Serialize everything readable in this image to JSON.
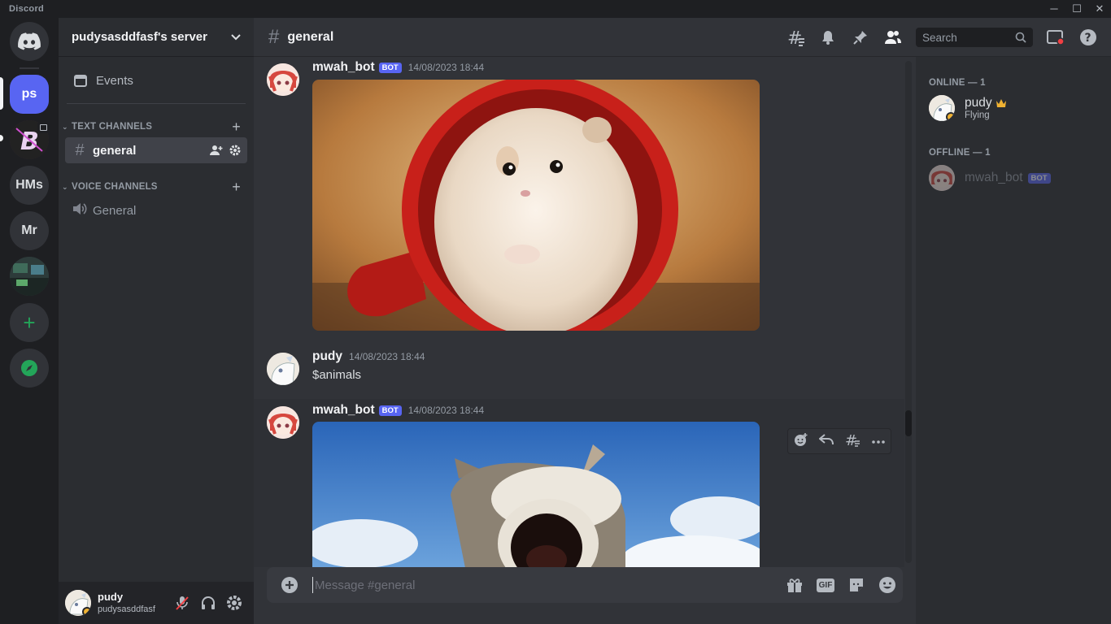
{
  "app": {
    "title": "Discord"
  },
  "window": {
    "minimize": "─",
    "maximize": "☐",
    "close": "✕"
  },
  "guilds": [
    {
      "label": "ps",
      "active": true
    },
    {
      "label": ""
    },
    {
      "label": "HMs"
    },
    {
      "label": "Mr"
    },
    {
      "label": ""
    }
  ],
  "server": {
    "name": "pudysasddfasf's server"
  },
  "sidebar": {
    "events_label": "Events",
    "text_category": "TEXT CHANNELS",
    "voice_category": "VOICE CHANNELS",
    "text_channels": [
      {
        "name": "general",
        "active": true
      }
    ],
    "voice_channels": [
      {
        "name": "General"
      }
    ]
  },
  "user": {
    "name": "pudy",
    "tag": "pudysasddfasf"
  },
  "channel": {
    "name": "general"
  },
  "header": {
    "search_placeholder": "Search"
  },
  "messages": [
    {
      "author": "mwah_bot",
      "bot": true,
      "bot_label": "BOT",
      "timestamp": "14/08/2023 18:44",
      "content": "",
      "attachment": "hamster-in-red-cup"
    },
    {
      "author": "pudy",
      "bot": false,
      "timestamp": "14/08/2023 18:44",
      "content": "$animals"
    },
    {
      "author": "mwah_bot",
      "bot": true,
      "bot_label": "BOT",
      "timestamp": "14/08/2023 18:44",
      "content": "",
      "attachment": "pop-cat"
    }
  ],
  "composer": {
    "placeholder": "Message #general",
    "gif_label": "GIF"
  },
  "members": {
    "online_header": "ONLINE — 1",
    "offline_header": "OFFLINE — 1",
    "online": [
      {
        "name": "pudy",
        "status": "Flying"
      }
    ],
    "offline": [
      {
        "name": "mwah_bot",
        "bot_label": "BOT"
      }
    ]
  },
  "colors": {
    "accent": "#5865f2",
    "green": "#23a559",
    "sidebar": "#2b2d31",
    "chat": "#313338",
    "rail": "#1e1f22"
  }
}
